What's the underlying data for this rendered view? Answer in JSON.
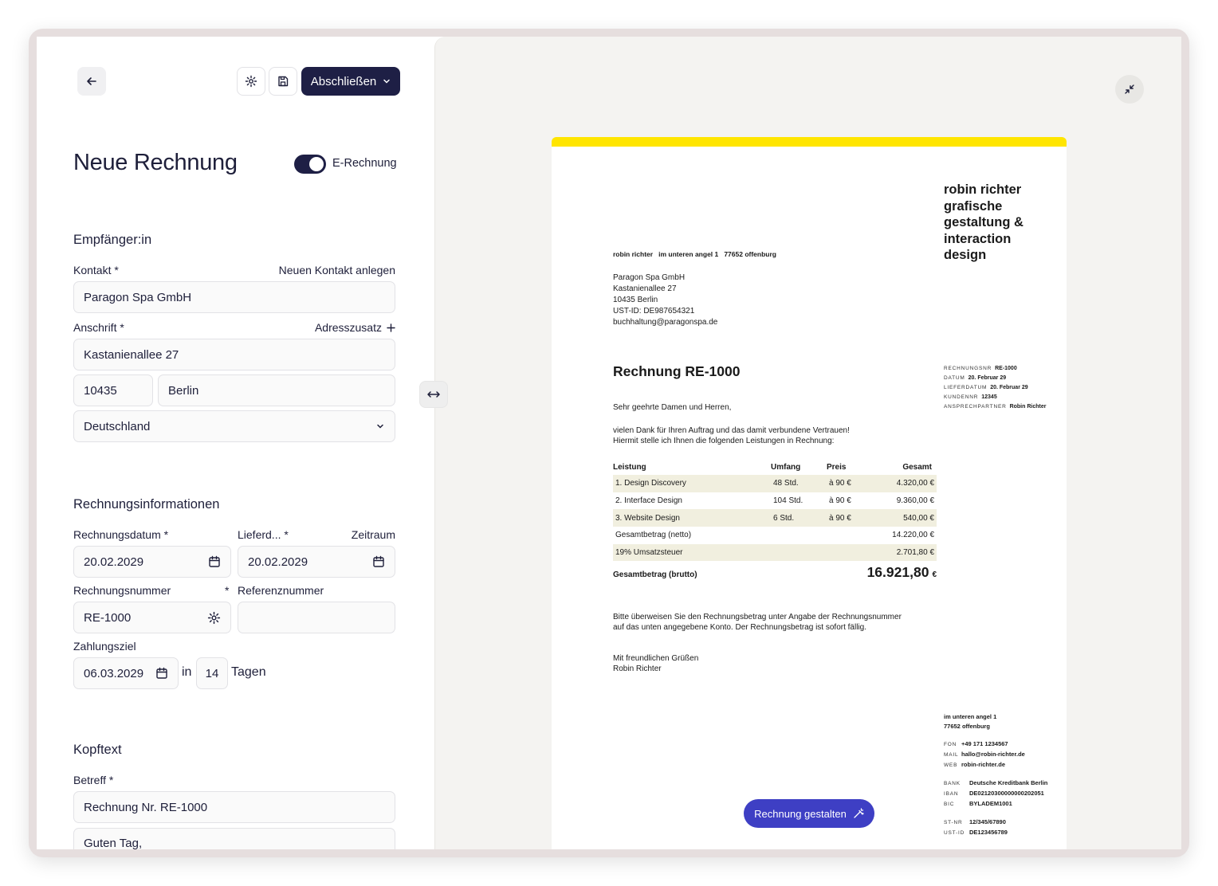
{
  "toolbar": {
    "back_icon": "arrow-left-icon",
    "settings_icon": "gear-icon",
    "save_icon": "save-icon",
    "finish_label": "Abschließen"
  },
  "header": {
    "title": "Neue Rechnung",
    "e_invoice_label": "E-Rechnung",
    "e_invoice_enabled": true
  },
  "recipient": {
    "section_title": "Empfänger:in",
    "contact_label": "Kontakt *",
    "new_contact_link": "Neuen Kontakt anlegen",
    "contact_value": "Paragon Spa GmbH",
    "address_label": "Anschrift *",
    "address_extra_link": "Adresszusatz",
    "street_value": "Kastanienallee 27",
    "zip_value": "10435",
    "city_value": "Berlin",
    "country_value": "Deutschland"
  },
  "invoice_info": {
    "section_title": "Rechnungsinformationen",
    "date_label": "Rechnungsdatum *",
    "delivery_label": "Lieferd... *",
    "period_link": "Zeitraum",
    "date_value": "20.02.2029",
    "delivery_value": "20.02.2029",
    "number_label": "Rechnungsnummer",
    "number_star": "*",
    "reference_label": "Referenznummer",
    "number_value": "RE-1000",
    "reference_value": "",
    "due_label": "Zahlungsziel",
    "due_value": "06.03.2029",
    "in_label": "in",
    "days_value": "14",
    "days_label": "Tagen"
  },
  "header_text": {
    "section_title": "Kopftext",
    "subject_label": "Betreff *",
    "subject_value": "Rechnung Nr. RE-1000",
    "body_value": "Guten Tag,"
  },
  "preview": {
    "brand": "robin richter grafische gestaltung & interaction design",
    "sender_line": "robin richter   im unteren angel 1   77652 offenburg",
    "recipient_lines": [
      "Paragon Spa GmbH",
      "Kastanienallee 27",
      "10435 Berlin",
      "UST-ID: DE987654321",
      "buchhaltung@paragonspa.de"
    ],
    "title": "Rechnung RE-1000",
    "meta": [
      {
        "k": "RECHNUNGSNR",
        "v": "RE-1000"
      },
      {
        "k": "DATUM",
        "v": "20. Februar 29"
      },
      {
        "k": "LIEFERDATUM",
        "v": "20. Februar 29"
      },
      {
        "k": "KUNDENNR",
        "v": "12345"
      },
      {
        "k": "ANSPRECHPARTNER",
        "v": "Robin Richter"
      }
    ],
    "greeting": "Sehr geehrte Damen und Herren,",
    "intro_1": "vielen Dank für Ihren Auftrag und das damit verbundene Vertrauen!",
    "intro_2": "Hiermit stelle ich Ihnen die folgenden Leistungen in Rechnung:",
    "table_headers": [
      "Leistung",
      "Umfang",
      "Preis",
      "Gesamt"
    ],
    "rows": [
      {
        "c1": "1. Design Discovery",
        "c2": "48 Std.",
        "c3": "à 90 €",
        "c4": "4.320,00 €"
      },
      {
        "c1": "2. Interface Design",
        "c2": "104 Std.",
        "c3": "à 90 €",
        "c4": "9.360,00 €"
      },
      {
        "c1": "3. Website Design",
        "c2": "6 Std.",
        "c3": "à 90 €",
        "c4": "540,00 €"
      }
    ],
    "net_label": "Gesamtbetrag (netto)",
    "net_value": "14.220,00 €",
    "tax_label": "19% Umsatzsteuer",
    "tax_value": "2.701,80 €",
    "gross_label": "Gesamtbetrag (brutto)",
    "gross_value": "16.921,80",
    "gross_currency": "€",
    "payment_1": "Bitte überweisen Sie den Rechnungsbetrag unter Angabe der Rechnungsnummer",
    "payment_2": "auf das unten angegebene Konto. Der Rechnungsbetrag ist sofort fällig.",
    "closing_1": "Mit freundlichen Grüßen",
    "closing_2": "Robin Richter",
    "footer_addr_1": "im unteren angel 1",
    "footer_addr_2": "77652 offenburg",
    "footer_contact": [
      {
        "k": "FON",
        "v": "+49 171 1234567"
      },
      {
        "k": "MAIL",
        "v": "hallo@robin-richter.de"
      },
      {
        "k": "WEB",
        "v": "robin-richter.de"
      }
    ],
    "footer_bank": [
      {
        "k": "BANK",
        "v": "Deutsche Kreditbank Berlin"
      },
      {
        "k": "IBAN",
        "v": "DE02120300000000202051"
      },
      {
        "k": "BIC",
        "v": "BYLADEM1001"
      }
    ],
    "footer_tax": [
      {
        "k": "ST-NR",
        "v": "12/345/67890"
      },
      {
        "k": "UST-ID",
        "v": "DE123456789"
      }
    ],
    "design_button": "Rechnung gestalten"
  },
  "colors": {
    "primary": "#1e1f45",
    "accent_yellow": "#ffe500",
    "design_button": "#3e3fc4",
    "preview_bg": "#f4f3f1"
  }
}
